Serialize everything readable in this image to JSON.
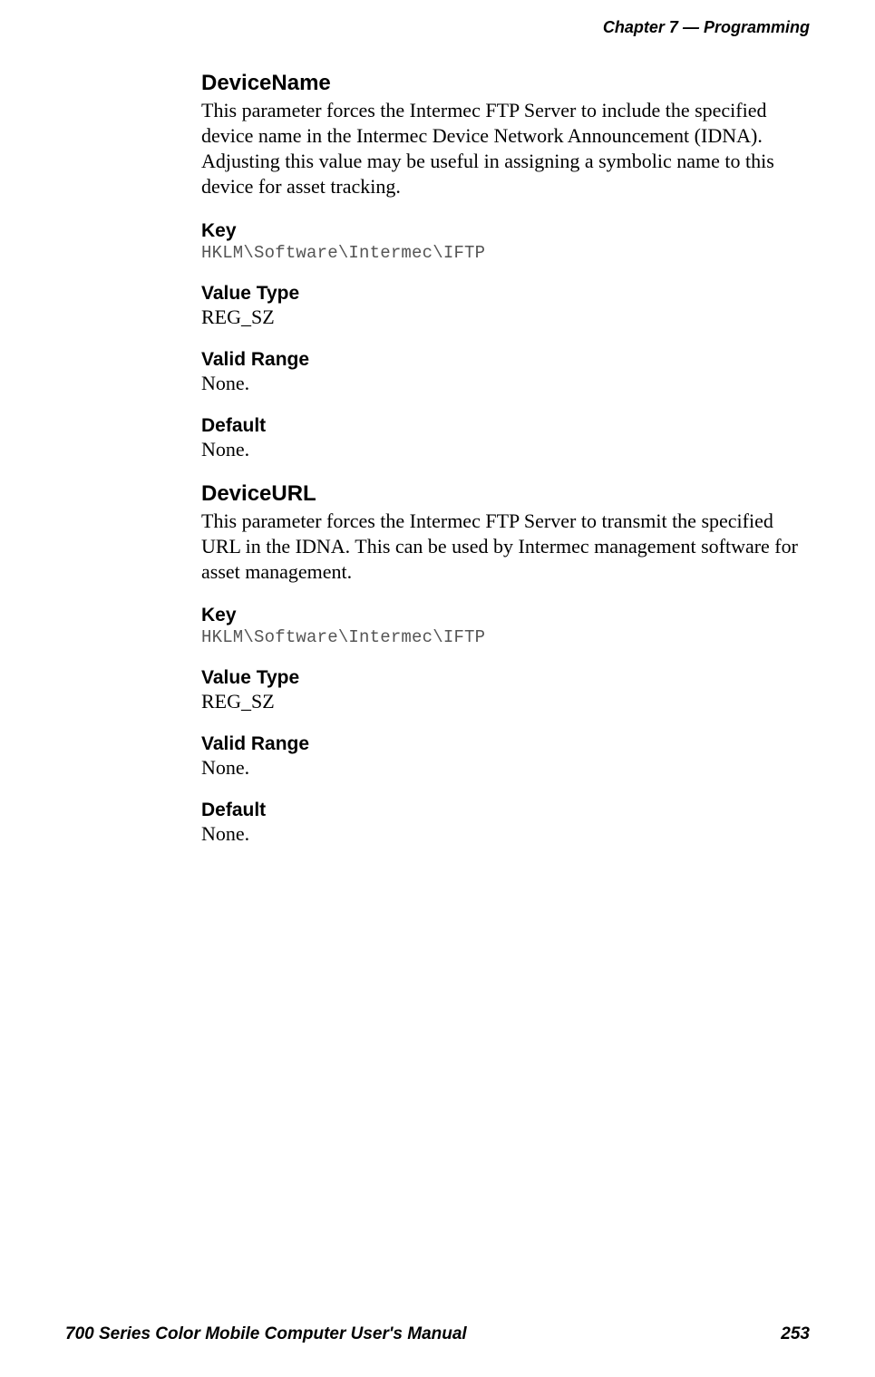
{
  "header": {
    "chapter_label": "Chapter",
    "chapter_number": "7",
    "separator": "—",
    "chapter_title": "Programming"
  },
  "sections": [
    {
      "title": "DeviceName",
      "description": "This parameter forces the Intermec FTP Server to include the specified device name in the Intermec Device Network Announcement (IDNA). Adjusting this value may be useful in assigning a symbolic name to this device for asset tracking.",
      "fields": [
        {
          "label": "Key",
          "value": "HKLM\\Software\\Intermec\\IFTP",
          "mono": true
        },
        {
          "label": "Value Type",
          "value": "REG_SZ",
          "mono": false
        },
        {
          "label": "Valid Range",
          "value": "None.",
          "mono": false
        },
        {
          "label": "Default",
          "value": "None.",
          "mono": false
        }
      ]
    },
    {
      "title": "DeviceURL",
      "description": "This parameter forces the Intermec FTP Server to transmit the specified URL in the IDNA. This can be used by Intermec management software for asset management.",
      "fields": [
        {
          "label": "Key",
          "value": "HKLM\\Software\\Intermec\\IFTP",
          "mono": true
        },
        {
          "label": "Value Type",
          "value": "REG_SZ",
          "mono": false
        },
        {
          "label": "Valid Range",
          "value": "None.",
          "mono": false
        },
        {
          "label": "Default",
          "value": "None.",
          "mono": false
        }
      ]
    }
  ],
  "footer": {
    "manual_title": "700 Series Color Mobile Computer User's Manual",
    "page_number": "253"
  }
}
